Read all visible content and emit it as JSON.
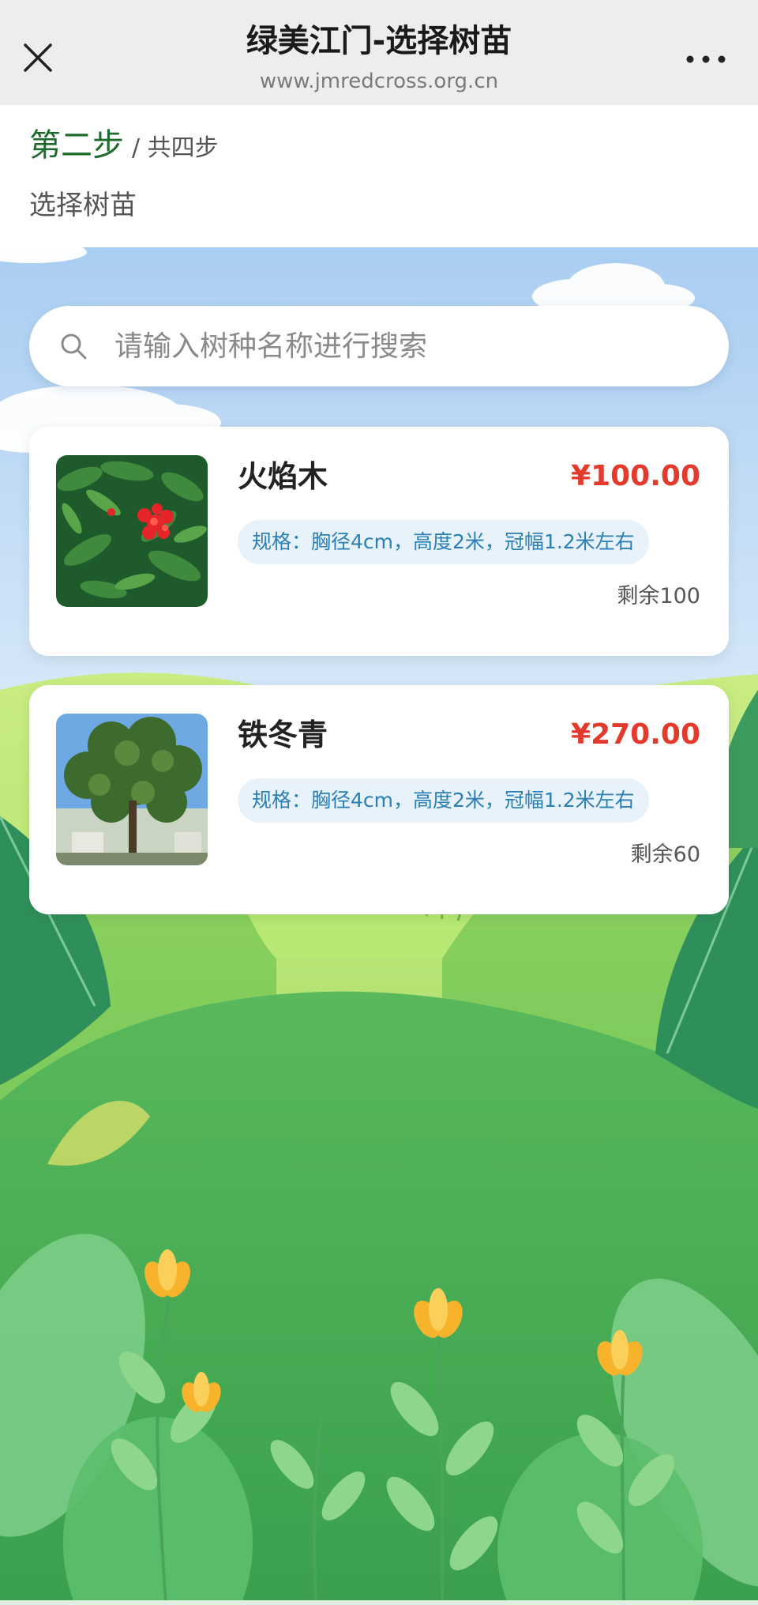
{
  "navbar": {
    "title": "绿美江门-选择树苗",
    "url": "www.jmredcross.org.cn",
    "close_icon": "close-icon",
    "more_icon": "more-icon"
  },
  "step": {
    "current": "第二步",
    "total": "/ 共四步",
    "subtitle": "选择树苗"
  },
  "search": {
    "placeholder": "请输入树种名称进行搜索",
    "value": "",
    "icon": "search-icon"
  },
  "products": [
    {
      "name": "火焰木",
      "price": "¥100.00",
      "spec": "规格：胸径4cm，高度2米，冠幅1.2米左右",
      "stock": "剩余100",
      "image": "flame-tree-photo"
    },
    {
      "name": "铁冬青",
      "price": "¥270.00",
      "spec": "规格：胸径4cm，高度2米，冠幅1.2米左右",
      "stock": "剩余60",
      "image": "holly-tree-photo"
    }
  ],
  "colors": {
    "step_accent": "#1e6b2e",
    "price": "#e23b2e",
    "spec_text": "#2a7fb5",
    "spec_bg": "#e8f2fb"
  }
}
